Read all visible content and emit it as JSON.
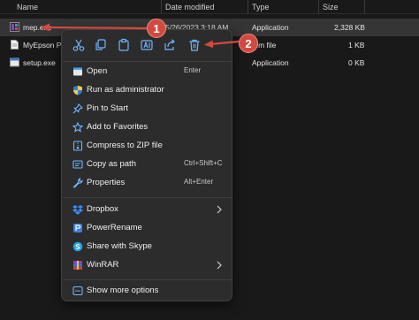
{
  "columns": {
    "name": "Name",
    "date": "Date modified",
    "type": "Type",
    "size": "Size"
  },
  "files": [
    {
      "name": "mep.exe",
      "date": "5/26/2023 3:18 AM",
      "type": "Application",
      "size": "2,328 KB"
    },
    {
      "name": "MyEpson Po",
      "type": "tem file",
      "size": "1 KB"
    },
    {
      "name": "setup.exe",
      "type": "Application",
      "size": "0 KB"
    }
  ],
  "quick_actions": [
    "scissors-icon",
    "copy-icon",
    "paste-icon",
    "rename-icon",
    "share-icon",
    "delete-icon"
  ],
  "menu": {
    "group1": [
      {
        "label": "Open",
        "shortcut": "Enter",
        "icon": "open-app-icon"
      },
      {
        "label": "Run as administrator",
        "shortcut": "",
        "icon": "shield-icon"
      },
      {
        "label": "Pin to Start",
        "shortcut": "",
        "icon": "pin-icon"
      },
      {
        "label": "Add to Favorites",
        "shortcut": "",
        "icon": "star-icon"
      },
      {
        "label": "Compress to ZIP file",
        "shortcut": "",
        "icon": "zip-icon"
      },
      {
        "label": "Copy as path",
        "shortcut": "Ctrl+Shift+C",
        "icon": "copy-path-icon"
      },
      {
        "label": "Properties",
        "shortcut": "Alt+Enter",
        "icon": "wrench-icon"
      }
    ],
    "group2": [
      {
        "label": "Dropbox",
        "icon": "dropbox-icon",
        "submenu": true
      },
      {
        "label": "PowerRename",
        "icon": "powerrename-icon",
        "submenu": false
      },
      {
        "label": "Share with Skype",
        "icon": "skype-icon",
        "submenu": false
      },
      {
        "label": "WinRAR",
        "icon": "winrar-icon",
        "submenu": true
      }
    ],
    "group3": [
      {
        "label": "Show more options",
        "icon": "more-options-icon"
      }
    ]
  },
  "annotations": {
    "badge1": "1",
    "badge2": "2",
    "color": "#d24a3f"
  }
}
